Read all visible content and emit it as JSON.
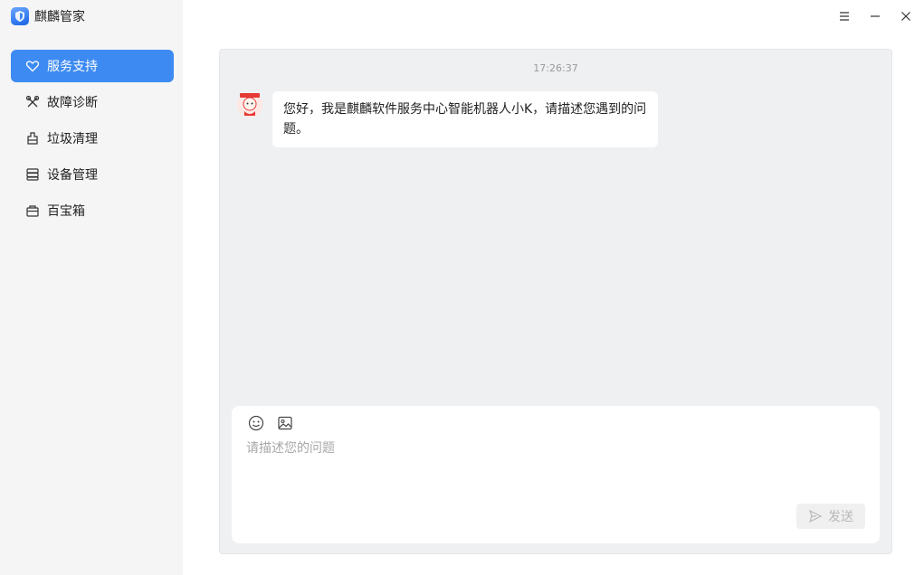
{
  "app": {
    "title": "麒麟管家"
  },
  "sidebar": {
    "items": [
      {
        "label": "服务支持",
        "icon": "heart-icon",
        "active": true
      },
      {
        "label": "故障诊断",
        "icon": "tools-icon",
        "active": false
      },
      {
        "label": "垃圾清理",
        "icon": "broom-icon",
        "active": false
      },
      {
        "label": "设备管理",
        "icon": "device-icon",
        "active": false
      },
      {
        "label": "百宝箱",
        "icon": "toolbox-icon",
        "active": false
      }
    ]
  },
  "window_controls": {
    "menu": "menu-icon",
    "minimize": "minimize-icon",
    "close": "close-icon"
  },
  "chat": {
    "timestamp": "17:26:37",
    "messages": [
      {
        "sender": "bot",
        "text": "您好，我是麒麟软件服务中心智能机器人小K，请描述您遇到的问题。"
      }
    ]
  },
  "input": {
    "placeholder": "请描述您的问题",
    "send_label": "发送"
  },
  "colors": {
    "accent": "#3d8bf2",
    "sidebar_bg": "#f5f5f6",
    "chat_bg": "#eff0f2"
  }
}
